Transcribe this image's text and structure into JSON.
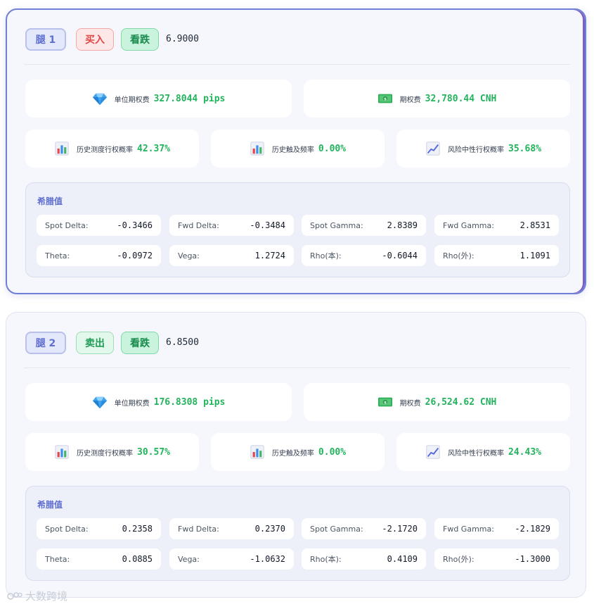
{
  "colors": {
    "accent": "#6f7fd6",
    "positive": "#22b35c",
    "buy": "#e04848",
    "sell": "#1f9d55"
  },
  "legs": [
    {
      "label": "腿 1",
      "direction": "买入",
      "type": "看跌",
      "strike": "6.9000",
      "unit_premium": {
        "icon": "diamond-icon",
        "label": "单位期权费",
        "value": "327.8044 pips"
      },
      "premium": {
        "icon": "money-icon",
        "label": "期权费",
        "value": "32,780.44 CNH"
      },
      "hist_exercise": {
        "icon": "bar-chart-icon",
        "label": "历史测度行权概率",
        "value": "42.37%"
      },
      "hist_touch": {
        "icon": "bar-chart-icon",
        "label": "历史触及频率",
        "value": "0.00%"
      },
      "risk_neutral": {
        "icon": "trend-chart-icon",
        "label": "风险中性行权概率",
        "value": "35.68%"
      },
      "greeks_title": "希腊值",
      "greeks": [
        {
          "label": "Spot Delta:",
          "value": "-0.3466"
        },
        {
          "label": "Fwd Delta:",
          "value": "-0.3484"
        },
        {
          "label": "Spot Gamma:",
          "value": "2.8389"
        },
        {
          "label": "Fwd Gamma:",
          "value": "2.8531"
        },
        {
          "label": "Theta:",
          "value": "-0.0972"
        },
        {
          "label": "Vega:",
          "value": "1.2724"
        },
        {
          "label": "Rho(本):",
          "value": "-0.6044"
        },
        {
          "label": "Rho(外):",
          "value": "1.1091"
        }
      ]
    },
    {
      "label": "腿 2",
      "direction": "卖出",
      "type": "看跌",
      "strike": "6.8500",
      "unit_premium": {
        "icon": "diamond-icon",
        "label": "单位期权费",
        "value": "176.8308 pips"
      },
      "premium": {
        "icon": "money-icon",
        "label": "期权费",
        "value": "26,524.62 CNH"
      },
      "hist_exercise": {
        "icon": "bar-chart-icon",
        "label": "历史测度行权概率",
        "value": "30.57%"
      },
      "hist_touch": {
        "icon": "bar-chart-icon",
        "label": "历史触及频率",
        "value": "0.00%"
      },
      "risk_neutral": {
        "icon": "trend-chart-icon",
        "label": "风险中性行权概率",
        "value": "24.43%"
      },
      "greeks_title": "希腊值",
      "greeks": [
        {
          "label": "Spot Delta:",
          "value": "0.2358"
        },
        {
          "label": "Fwd Delta:",
          "value": "0.2370"
        },
        {
          "label": "Spot Gamma:",
          "value": "-2.1720"
        },
        {
          "label": "Fwd Gamma:",
          "value": "-2.1829"
        },
        {
          "label": "Theta:",
          "value": "0.0885"
        },
        {
          "label": "Vega:",
          "value": "-1.0632"
        },
        {
          "label": "Rho(本):",
          "value": "0.4109"
        },
        {
          "label": "Rho(外):",
          "value": "-1.3000"
        }
      ]
    }
  ],
  "watermark": "大数跨境"
}
